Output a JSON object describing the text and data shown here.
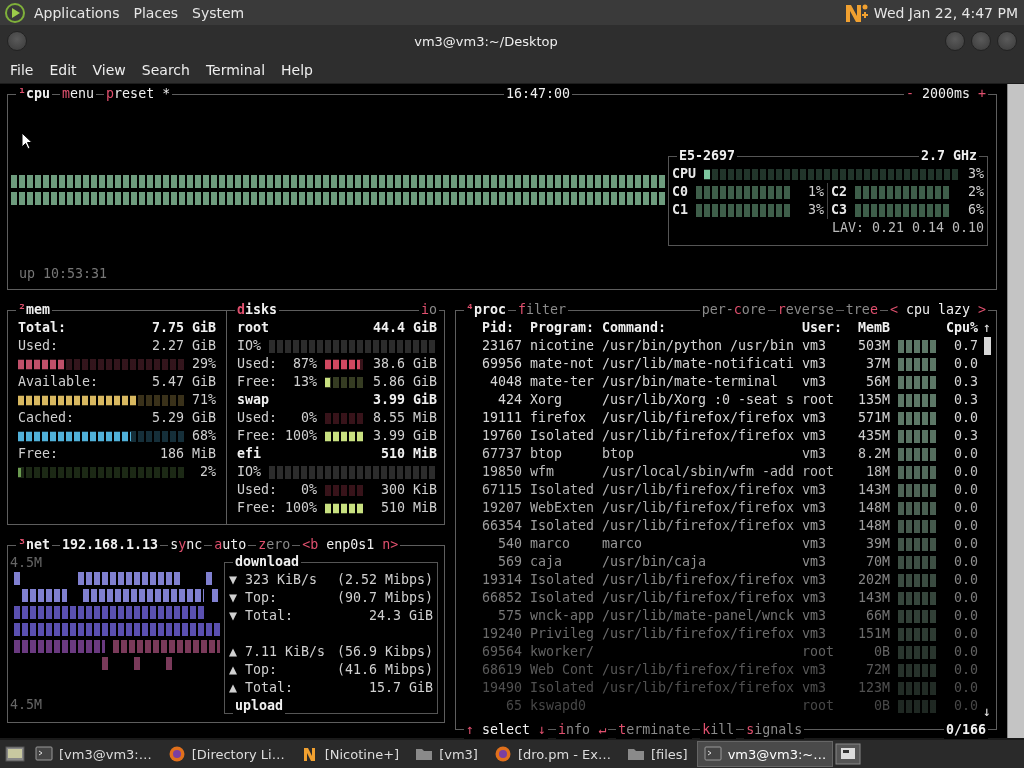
{
  "top_panel": {
    "menus": [
      "Applications",
      "Places",
      "System"
    ],
    "clock": "Wed Jan 22, 4:47 PM"
  },
  "window": {
    "title": "vm3@vm3:~/Desktop"
  },
  "menu_bar": [
    "File",
    "Edit",
    "View",
    "Search",
    "Terminal",
    "Help"
  ],
  "cpu_box": {
    "title_left": [
      {
        "kind": "title",
        "on": true,
        "segments": [
          {
            "text": "¹",
            "hot": true
          },
          {
            "text": "cpu",
            "hot": false
          }
        ]
      },
      {
        "kind": "option",
        "on": true,
        "segments": [
          {
            "text": "m",
            "hot": true
          },
          {
            "text": "enu",
            "hot": false
          }
        ]
      },
      {
        "kind": "option",
        "on": true,
        "segments": [
          {
            "text": "p",
            "hot": true
          },
          {
            "text": "reset *",
            "hot": false
          }
        ]
      }
    ],
    "clock": "16:47:00",
    "title_right": [
      {
        "kind": "option",
        "on": true,
        "segments": [
          {
            "text": "-",
            "hot": true
          },
          {
            "text": " 2000ms ",
            "hot": false
          },
          {
            "text": "+",
            "hot": true
          }
        ]
      }
    ],
    "uptime": "up 10:53:31",
    "model": "E5-2697",
    "freq": "2.7 GHz",
    "total": {
      "label": "CPU",
      "level": 0.03,
      "reading": "3%"
    },
    "cores": [
      {
        "label": "C0",
        "reading": "1%"
      },
      {
        "label": "C2",
        "reading": "2%"
      },
      {
        "label": "C1",
        "reading": "3%"
      },
      {
        "label": "C3",
        "reading": "6%"
      }
    ],
    "load": "LAV: 0.21 0.14 0.10"
  },
  "mem_box": {
    "title": {
      "kind": "title",
      "on": true,
      "segments": [
        {
          "text": "²",
          "hot": true
        },
        {
          "text": "mem",
          "hot": false
        }
      ]
    },
    "rows": [
      {
        "kind": "total",
        "label": "Total:",
        "value": "7.75 GiB"
      },
      {
        "kind": "meter",
        "label": "Used:",
        "value": "2.27 GiB",
        "level": 0.29,
        "reading": "29%",
        "color": "#c0506a"
      },
      {
        "kind": "meter",
        "label": "Available:",
        "value": "5.47 GiB",
        "level": 0.71,
        "reading": "71%",
        "color": "#d8b860"
      },
      {
        "kind": "meter",
        "label": "Cached:",
        "value": "5.29 GiB",
        "level": 0.68,
        "reading": "68%",
        "color": "#50b0d8"
      },
      {
        "kind": "meter",
        "label": "Free:",
        "value": "186 MiB",
        "level": 0.02,
        "reading": "2%",
        "color": "#6a9a50"
      }
    ]
  },
  "disks_box": {
    "title": {
      "kind": "title",
      "on": true,
      "segments": [
        {
          "text": "d",
          "hot": true
        },
        {
          "text": "isks",
          "hot": false
        }
      ]
    },
    "io_toggle": {
      "kind": "option",
      "on": false,
      "segments": [
        {
          "text": "i",
          "hot": true
        },
        {
          "text": "o",
          "hot": false
        }
      ]
    },
    "disks": [
      {
        "name": "root",
        "size": "44.4 GiB",
        "io_label": "IO%",
        "used": {
          "label": "Used:",
          "reading": "87%",
          "level": 0.87,
          "value": "38.6 GiB"
        },
        "free": {
          "label": "Free:",
          "reading": "13%",
          "level": 0.13,
          "value": "5.86 GiB"
        }
      },
      {
        "name": "swap",
        "size": "3.99 GiB",
        "used": {
          "label": "Used:",
          "reading": "0%",
          "level": 0,
          "value": "8.55 MiB"
        },
        "free": {
          "label": "Free:",
          "reading": "100%",
          "level": 1,
          "value": "3.99 GiB"
        }
      },
      {
        "name": "efi",
        "size": "510 MiB",
        "io_label": "IO%",
        "used": {
          "label": "Used:",
          "reading": "0%",
          "level": 0,
          "value": "300 KiB"
        },
        "free": {
          "label": "Free:",
          "reading": "100%",
          "level": 1,
          "value": "510 MiB"
        }
      }
    ]
  },
  "net_box": {
    "title": [
      {
        "kind": "title",
        "on": true,
        "segments": [
          {
            "text": "³",
            "hot": true
          },
          {
            "text": "net",
            "hot": false
          }
        ]
      },
      {
        "kind": "label",
        "on": true,
        "segments": [
          {
            "text": "192.168.1.13",
            "hot": false
          }
        ]
      },
      {
        "kind": "option",
        "on": true,
        "segments": [
          {
            "text": "s",
            "hot": false
          },
          {
            "text": "y",
            "hot": true
          },
          {
            "text": "nc",
            "hot": false
          }
        ]
      },
      {
        "kind": "option",
        "on": true,
        "segments": [
          {
            "text": "a",
            "hot": true
          },
          {
            "text": "uto",
            "hot": false
          }
        ]
      },
      {
        "kind": "option",
        "on": false,
        "segments": [
          {
            "text": "z",
            "hot": true
          },
          {
            "text": "ero",
            "hot": false
          }
        ]
      },
      {
        "kind": "option",
        "on": true,
        "segments": [
          {
            "text": "<b",
            "hot": true
          },
          {
            "text": " enp0s1 ",
            "hot": false
          },
          {
            "text": "n>",
            "hot": true
          }
        ]
      }
    ],
    "scale_top": "4.5M",
    "scale_bottom": "4.5M",
    "download": {
      "title": "download",
      "rows": [
        {
          "arrow": "▼",
          "label": "323 KiB/s",
          "value": "(2.52 Mibps)"
        },
        {
          "arrow": "▼",
          "label": "Top:",
          "value": "(90.7 Mibps)"
        },
        {
          "arrow": "▼",
          "label": "Total:",
          "value": "24.3 GiB"
        }
      ]
    },
    "upload": {
      "title": "upload",
      "rows": [
        {
          "arrow": "▲",
          "label": "7.11 KiB/s",
          "value": "(56.9 Kibps)"
        },
        {
          "arrow": "▲",
          "label": "Top:",
          "value": "(41.6 Mibps)"
        },
        {
          "arrow": "▲",
          "label": "Total:",
          "value": "15.7 GiB"
        }
      ]
    }
  },
  "proc_box": {
    "title_left": [
      {
        "kind": "title",
        "on": true,
        "segments": [
          {
            "text": "⁴",
            "hot": true
          },
          {
            "text": "proc",
            "hot": false
          }
        ]
      },
      {
        "kind": "option",
        "on": false,
        "segments": [
          {
            "text": "f",
            "hot": true
          },
          {
            "text": "ilter",
            "hot": false
          }
        ]
      }
    ],
    "title_right": [
      {
        "kind": "option",
        "on": false,
        "segments": [
          {
            "text": "per-",
            "hot": false
          },
          {
            "text": "c",
            "hot": true
          },
          {
            "text": "ore",
            "hot": false
          }
        ]
      },
      {
        "kind": "option",
        "on": false,
        "segments": [
          {
            "text": "r",
            "hot": true
          },
          {
            "text": "everse",
            "hot": false
          }
        ]
      },
      {
        "kind": "option",
        "on": false,
        "segments": [
          {
            "text": "tre",
            "hot": false
          },
          {
            "text": "e",
            "hot": true
          }
        ]
      },
      {
        "kind": "option",
        "on": true,
        "segments": [
          {
            "text": "<",
            "hot": true
          },
          {
            "text": " cpu lazy ",
            "hot": false
          },
          {
            "text": ">",
            "hot": true
          }
        ]
      }
    ],
    "columns": [
      "Pid:",
      "Program:",
      "Command:",
      "User:",
      "MemB",
      "Cpu%"
    ],
    "rows": [
      {
        "pid": "23167",
        "program": "nicotine",
        "command": "/usr/bin/python /usr/bin",
        "user": "vm3",
        "mem": "503M",
        "cpu": "0.7"
      },
      {
        "pid": "69956",
        "program": "mate-not",
        "command": "/usr/lib/mate-notificati",
        "user": "vm3",
        "mem": "37M",
        "cpu": "0.0"
      },
      {
        "pid": "4048",
        "program": "mate-ter",
        "command": "/usr/bin/mate-terminal",
        "user": "vm3",
        "mem": "56M",
        "cpu": "0.3"
      },
      {
        "pid": "424",
        "program": "Xorg",
        "command": "/usr/lib/Xorg :0 -seat s",
        "user": "root",
        "mem": "135M",
        "cpu": "0.3"
      },
      {
        "pid": "19111",
        "program": "firefox",
        "command": "/usr/lib/firefox/firefox",
        "user": "vm3",
        "mem": "571M",
        "cpu": "0.0"
      },
      {
        "pid": "19760",
        "program": "Isolated",
        "command": "/usr/lib/firefox/firefox",
        "user": "vm3",
        "mem": "435M",
        "cpu": "0.3"
      },
      {
        "pid": "67737",
        "program": "btop",
        "command": "btop",
        "user": "vm3",
        "mem": "8.2M",
        "cpu": "0.0"
      },
      {
        "pid": "19850",
        "program": "wfm",
        "command": "/usr/local/sbin/wfm -add",
        "user": "root",
        "mem": "18M",
        "cpu": "0.0"
      },
      {
        "pid": "67115",
        "program": "Isolated",
        "command": "/usr/lib/firefox/firefox",
        "user": "vm3",
        "mem": "143M",
        "cpu": "0.0"
      },
      {
        "pid": "19207",
        "program": "WebExten",
        "command": "/usr/lib/firefox/firefox",
        "user": "vm3",
        "mem": "148M",
        "cpu": "0.0"
      },
      {
        "pid": "66354",
        "program": "Isolated",
        "command": "/usr/lib/firefox/firefox",
        "user": "vm3",
        "mem": "148M",
        "cpu": "0.0"
      },
      {
        "pid": "540",
        "program": "marco",
        "command": "marco",
        "user": "vm3",
        "mem": "39M",
        "cpu": "0.0"
      },
      {
        "pid": "569",
        "program": "caja",
        "command": "/usr/bin/caja",
        "user": "vm3",
        "mem": "70M",
        "cpu": "0.0"
      },
      {
        "pid": "19314",
        "program": "Isolated",
        "command": "/usr/lib/firefox/firefox",
        "user": "vm3",
        "mem": "202M",
        "cpu": "0.0"
      },
      {
        "pid": "66852",
        "program": "Isolated",
        "command": "/usr/lib/firefox/firefox",
        "user": "vm3",
        "mem": "143M",
        "cpu": "0.0"
      },
      {
        "pid": "575",
        "program": "wnck-app",
        "command": "/usr/lib/mate-panel/wnck",
        "user": "vm3",
        "mem": "66M",
        "cpu": "0.0"
      },
      {
        "pid": "19240",
        "program": "Privileg",
        "command": "/usr/lib/firefox/firefox",
        "user": "vm3",
        "mem": "151M",
        "cpu": "0.0"
      },
      {
        "pid": "69564",
        "program": "kworker/",
        "user": "root",
        "mem": "0B",
        "cpu": "0.0"
      },
      {
        "pid": "68619",
        "program": "Web Cont",
        "command": "/usr/lib/firefox/firefox",
        "user": "vm3",
        "mem": "72M",
        "cpu": "0.0"
      },
      {
        "pid": "19490",
        "program": "Isolated",
        "command": "/usr/lib/firefox/firefox",
        "user": "vm3",
        "mem": "123M",
        "cpu": "0.0"
      },
      {
        "pid": "65",
        "program": "kswapd0",
        "user": "root",
        "mem": "0B",
        "cpu": "0.0"
      }
    ],
    "scroll_up": "↑",
    "scroll_down": "↓",
    "footer": [
      {
        "kind": "option",
        "on": true,
        "segments": [
          {
            "text": "↑",
            "hot": true
          },
          {
            "text": " select ",
            "hot": false
          },
          {
            "text": "↓",
            "hot": true
          }
        ]
      },
      {
        "kind": "option",
        "on": false,
        "segments": [
          {
            "text": "i",
            "hot": true
          },
          {
            "text": "nfo ",
            "hot": false
          },
          {
            "text": "↵",
            "hot": true
          }
        ]
      },
      {
        "kind": "option",
        "on": false,
        "segments": [
          {
            "text": "t",
            "hot": true
          },
          {
            "text": "erminate",
            "hot": false
          }
        ]
      },
      {
        "kind": "option",
        "on": false,
        "segments": [
          {
            "text": "k",
            "hot": true
          },
          {
            "text": "ill",
            "hot": false
          }
        ]
      },
      {
        "kind": "option",
        "on": false,
        "segments": [
          {
            "text": "s",
            "hot": true
          },
          {
            "text": "ignals",
            "hot": false
          }
        ]
      }
    ],
    "count": "0/166"
  },
  "taskbar": [
    {
      "kind": "terminal",
      "label": "[vm3@vm3:…",
      "selected": false
    },
    {
      "kind": "browser",
      "label": "[Directory Li…",
      "selected": false
    },
    {
      "kind": "app",
      "label": "[Nicotine+]",
      "selected": false
    },
    {
      "kind": "folder",
      "label": "[vm3]",
      "selected": false
    },
    {
      "kind": "browser",
      "label": "[dro.pm - Ex…",
      "selected": false
    },
    {
      "kind": "folder",
      "label": "[files]",
      "selected": false
    },
    {
      "kind": "terminal",
      "label": "vm3@vm3:~…",
      "selected": true
    }
  ]
}
